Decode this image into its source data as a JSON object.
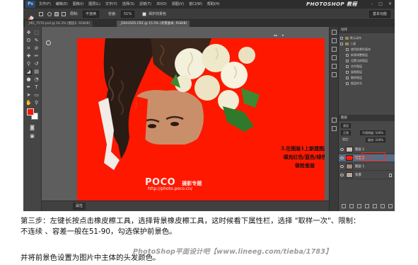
{
  "app": {
    "logo": "Ps",
    "menu": [
      "文件(F)",
      "编辑(E)",
      "图像(I)",
      "图层(L)",
      "文字(Y)",
      "选择(S)",
      "滤镜(T)",
      "3D(D)",
      "视图(V)",
      "窗口(W)",
      "帮助(H)"
    ],
    "window_controls": [
      "–",
      "□",
      "✕"
    ],
    "overlay_logo": "PHOTOSHOP 教程"
  },
  "options_bar": {
    "sample_label": "取样:",
    "sample_value": "一次",
    "limits_label": "限制:",
    "limits_value": "不连续",
    "tolerance_label": "容差:",
    "tolerance_value": "51%",
    "antialias_label": "消除锯齿",
    "contiguous_label": "连续",
    "protect_label": "保护前景色",
    "workspace": "基本功能"
  },
  "tabs": [
    "_MG_7570.psd @ 16.3% (图层2, RGB/8)",
    "_DSA3505.CR2 @ 15.5% (背景副本, RGB/8)"
  ],
  "canvas": {
    "annotation_lines": [
      "3.在图层1上新建图层",
      "填充红色/蓝色/绿色",
      "做检查层"
    ],
    "watermark_brand": "POCO",
    "watermark_brand_sub": "摄影专题",
    "watermark_url": "http://photo.poco.cn/",
    "top_icons": [
      "▴▴",
      "▸"
    ],
    "colors": {
      "background_red": "#ff1800",
      "foreground": "#ff1500"
    }
  },
  "status": {
    "panel_label": "属性"
  },
  "actions_panel": {
    "title": "动作",
    "rows": [
      {
        "label": "默认动作",
        "folder": true
      },
      {
        "label": "三道",
        "folder": true
      },
      {
        "label": "使用前景色填充",
        "folder": false
      },
      {
        "label": "新建调整图层",
        "folder": false
      },
      {
        "label": "设置当前图层",
        "folder": false
      },
      {
        "label": "合并图层",
        "folder": false
      },
      {
        "label": "复制图层",
        "folder": false
      },
      {
        "label": "删除图层",
        "folder": false
      },
      {
        "label": "图层样式",
        "folder": false
      }
    ]
  },
  "layers_panel": {
    "header": "图层",
    "kind_filter": "类型",
    "blend_mode": "正常",
    "opacity": "不透明度: 100%",
    "fill": "填充: 100%",
    "lock_label": "锁定:",
    "layers": [
      {
        "name": "图层 2",
        "thumb": "#c9bfb4",
        "selected": false
      },
      {
        "name": "检查层",
        "thumb": "#ff1800",
        "selected": true
      },
      {
        "name": "图层 1",
        "thumb": "#a08a78",
        "selected": false
      },
      {
        "name": "背景",
        "thumb": "#b8a896",
        "selected": false
      }
    ]
  },
  "caption": {
    "line1": "第三步：左键长按点击橡皮檫工具，选择背景橡皮檫工具，这时候看下属性栏，选择 \"取样一次\"、限制：",
    "line2": "不连续 、容差一般在51-90，勾选保护前景色。",
    "line3": "并将前景色设置为图片中主体的头发颜色。",
    "watermark": "PhotoShop平面设计吧【www.lineeg.com/tieba/1783】"
  }
}
